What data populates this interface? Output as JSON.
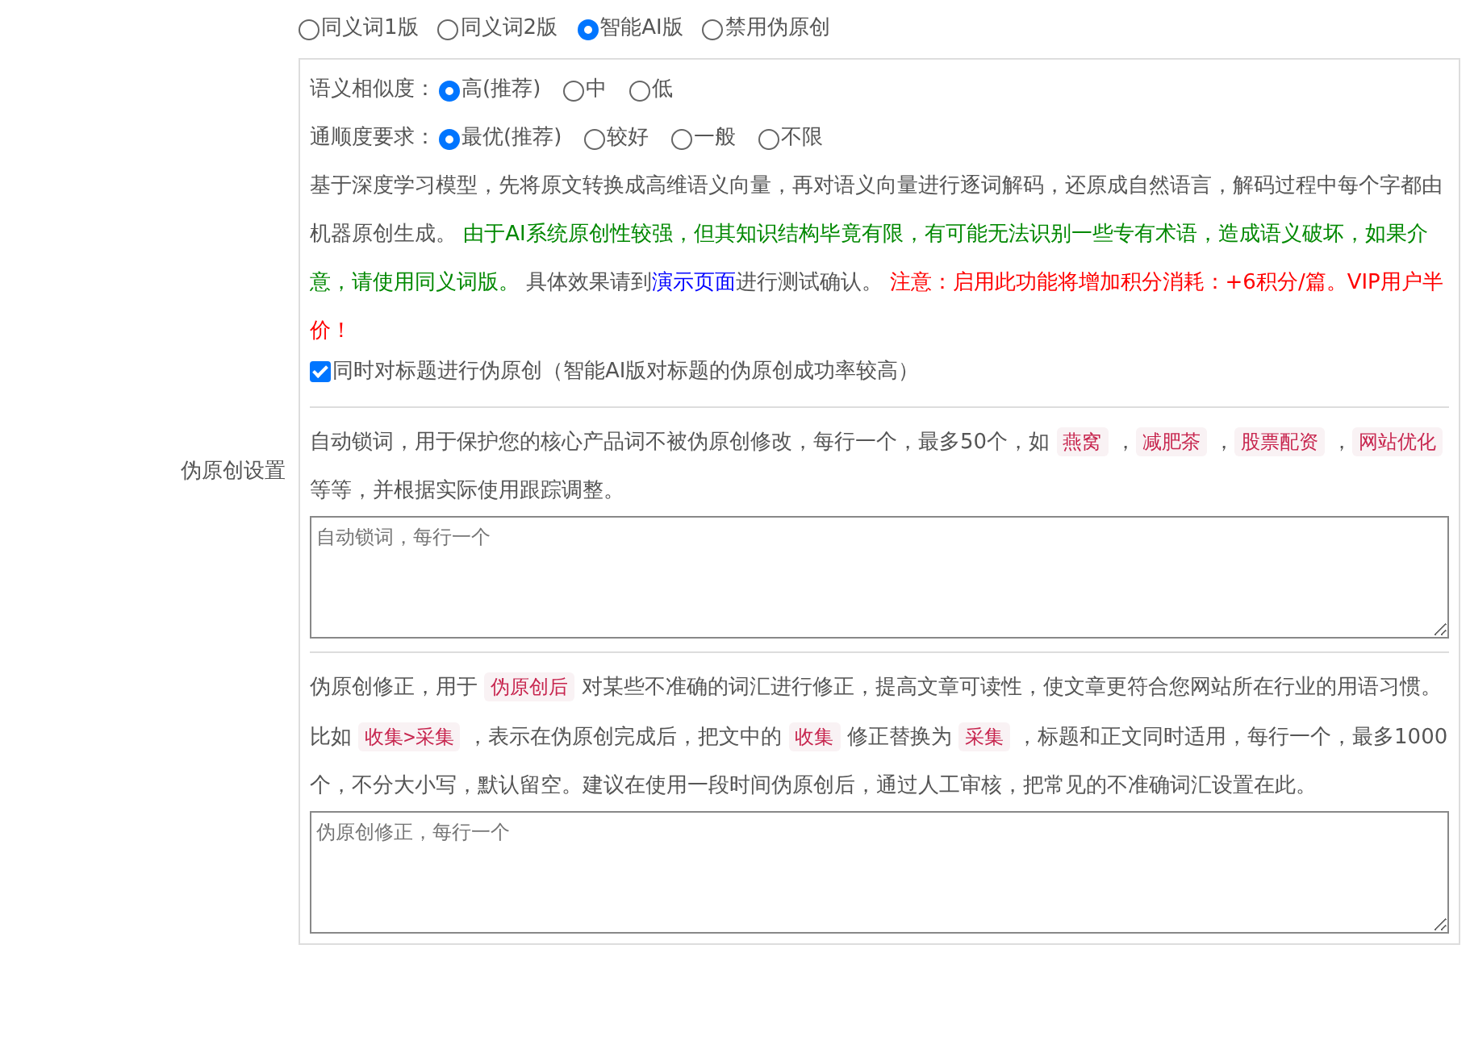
{
  "side_label": "伪原创设置",
  "modes": [
    {
      "label": "同义词1版",
      "selected": false
    },
    {
      "label": "同义词2版",
      "selected": false
    },
    {
      "label": "智能AI版",
      "selected": true
    },
    {
      "label": "禁用伪原创",
      "selected": false
    }
  ],
  "settings": [
    {
      "label": "语义相似度：",
      "options": [
        {
          "label": "高(推荐)",
          "selected": true
        },
        {
          "label": "中",
          "selected": false
        },
        {
          "label": "低",
          "selected": false
        }
      ]
    },
    {
      "label": "通顺度要求：",
      "options": [
        {
          "label": "最优(推荐)",
          "selected": true
        },
        {
          "label": "较好",
          "selected": false
        },
        {
          "label": "一般",
          "selected": false
        },
        {
          "label": "不限",
          "selected": false
        }
      ]
    }
  ],
  "ai_note": [
    {
      "kind": "plain",
      "text": "基于深度学习模型，先将原文转换成高维语义向量，再对语义向量进行逐词解码，还原成自然语言，解码过程中每个字都由机器原创生成。 "
    },
    {
      "kind": "green",
      "text": "由于AI系统原创性较强，但其知识结构毕竟有限，有可能无法识别一些专有术语，造成语义破坏，如果介意，请使用同义词版。"
    },
    {
      "kind": "plain",
      "text": " 具体效果请到"
    },
    {
      "kind": "link",
      "text": "演示页面"
    },
    {
      "kind": "plain",
      "text": "进行测试确认。 "
    },
    {
      "kind": "red",
      "text": "注意：启用此功能将增加积分消耗：+6积分/篇。VIP用户半价！"
    }
  ],
  "title_option": {
    "label": "同时对标题进行伪原创（智能AI版对标题的伪原创成功率较高）",
    "checked": true
  },
  "lock_note": [
    {
      "kind": "plain",
      "text": "自动锁词，用于保护您的核心产品词不被伪原创修改，每行一个，最多50个，如 "
    },
    {
      "kind": "code",
      "text": "燕窝"
    },
    {
      "kind": "plain",
      "text": " ，"
    },
    {
      "kind": "code",
      "text": "减肥茶"
    },
    {
      "kind": "plain",
      "text": " ，"
    },
    {
      "kind": "code",
      "text": "股票配资"
    },
    {
      "kind": "plain",
      "text": " ，"
    },
    {
      "kind": "code",
      "text": "网站优化"
    },
    {
      "kind": "plain",
      "text": " 等等，并根据实际使用跟踪调整。"
    }
  ],
  "lock_field": {
    "placeholder": "自动锁词，每行一个"
  },
  "fix_note": [
    {
      "kind": "plain",
      "text": "伪原创修正，用于 "
    },
    {
      "kind": "code",
      "text": "伪原创后"
    },
    {
      "kind": "plain",
      "text": " 对某些不准确的词汇进行修正，提高文章可读性，使文章更符合您网站所在行业的用语习惯。比如 "
    },
    {
      "kind": "code",
      "text": "收集>采集"
    },
    {
      "kind": "plain",
      "text": " ，表示在伪原创完成后，把文中的 "
    },
    {
      "kind": "code",
      "text": "收集"
    },
    {
      "kind": "plain",
      "text": " 修正替换为 "
    },
    {
      "kind": "code",
      "text": "采集"
    },
    {
      "kind": "plain",
      "text": " ，标题和正文同时适用，每行一个，最多1000个，不分大小写，默认留空。建议在使用一段时间伪原创后，通过人工审核，把常见的不准确词汇设置在此。"
    }
  ],
  "fix_field": {
    "placeholder": "伪原创修正，每行一个"
  }
}
